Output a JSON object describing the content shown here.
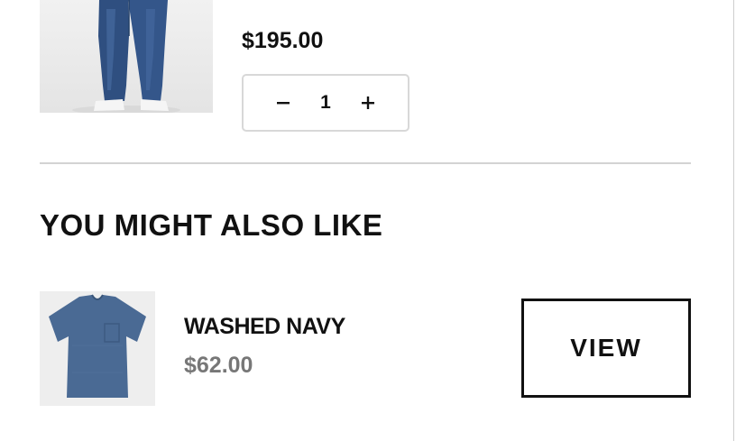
{
  "cart_item": {
    "price": "$195.00",
    "quantity": "1",
    "image_alt": "jeans"
  },
  "recommendations": {
    "title": "YOU MIGHT ALSO LIKE",
    "items": [
      {
        "name": "WASHED NAVY",
        "price": "$62.00",
        "button_label": "VIEW",
        "image_alt": "navy pocket t-shirt"
      }
    ]
  },
  "icons": {
    "decrement": "minus-icon",
    "increment": "plus-icon"
  },
  "colors": {
    "text": "#111111",
    "muted_price": "#777777",
    "border": "#d8d8d8",
    "shirt": "#4a6a94",
    "denim": "#2f4f80"
  }
}
